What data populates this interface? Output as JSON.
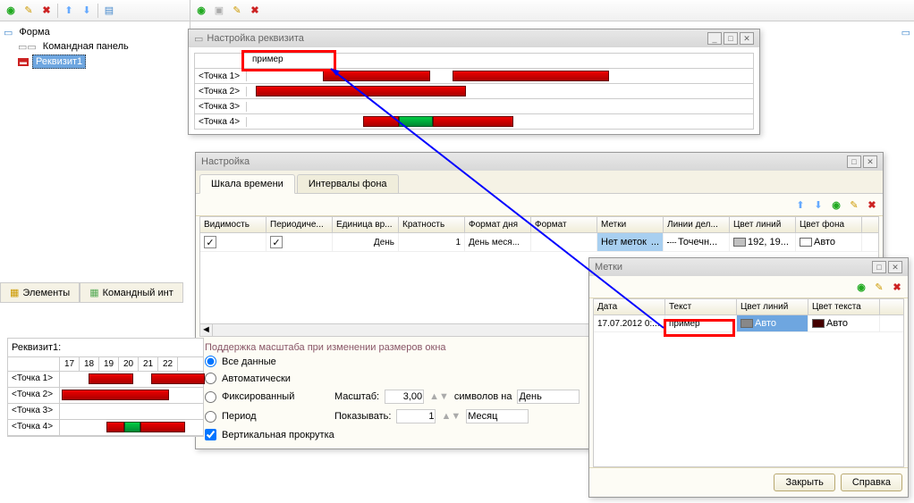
{
  "top_toolbar": {
    "items": [
      "add",
      "edit",
      "delete",
      "up",
      "down",
      "paste"
    ]
  },
  "tree": {
    "form": "Форма",
    "command_panel": "Командная панель",
    "attr1": "Реквизит1"
  },
  "attr_window": {
    "title": "Настройка реквизита",
    "example": "пример",
    "points": [
      "<Точка 1>",
      "<Точка 2>",
      "<Точка 3>",
      "<Точка 4>"
    ]
  },
  "settings_window": {
    "title": "Настройка",
    "tab1": "Шкала времени",
    "tab2": "Интервалы фона",
    "grid_headers": [
      "Видимость",
      "Периодиче...",
      "Единица вр...",
      "Кратность",
      "Формат дня",
      "Формат",
      "Метки",
      "Линии дел...",
      "Цвет линий",
      "Цвет фона"
    ],
    "grid_row": {
      "visibility": "✓",
      "periodic": "✓",
      "unit": "День",
      "mult": "1",
      "dayfmt": "День меся...",
      "fmt": "",
      "labels": "Нет меток",
      "lines": "Точечн...",
      "linecolor": "192, 19...",
      "bgcolor": "Авто"
    },
    "scale_section": {
      "title": "Поддержка масштаба при изменении размеров окна",
      "all_data": "Все данные",
      "auto": "Автоматически",
      "fixed": "Фиксированный",
      "period": "Период",
      "scale_lbl": "Масштаб:",
      "scale_val": "3,00",
      "chars_per": "символов на",
      "unit1": "День",
      "show_lbl": "Показывать:",
      "show_val": "1",
      "unit2": "Месяц",
      "vscroll": "Вертикальная прокрутка"
    }
  },
  "labels_window": {
    "title": "Метки",
    "headers": [
      "Дата",
      "Текст",
      "Цвет линий",
      "Цвет текста"
    ],
    "row": {
      "date": "17.07.2012 0:...",
      "text": "пример",
      "linecolor": "Авто",
      "textcolor": "Авто"
    },
    "close_btn": "Закрыть",
    "help_btn": "Справка"
  },
  "bottom_tabs": {
    "elements": "Элементы",
    "command_int": "Командный инт"
  },
  "bottom_preview": {
    "title": "Реквизит1:",
    "cols": [
      "17",
      "18",
      "19",
      "20",
      "21",
      "22"
    ],
    "rows": [
      "<Точка 1>",
      "<Точка 2>",
      "<Точка 3>",
      "<Точка 4>"
    ]
  }
}
